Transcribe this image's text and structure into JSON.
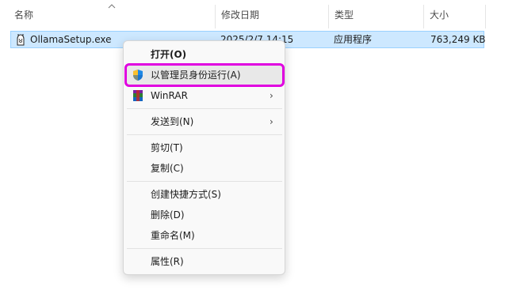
{
  "columns": {
    "name": "名称",
    "date": "修改日期",
    "type": "类型",
    "size": "大小"
  },
  "file": {
    "name": "OllamaSetup.exe",
    "date": "2025/2/7 14:15",
    "type": "应用程序",
    "size": "763,249 KB"
  },
  "menu": {
    "open": "打开(O)",
    "run_as_admin": "以管理员身份运行(A)",
    "winrar": "WinRAR",
    "send_to": "发送到(N)",
    "cut": "剪切(T)",
    "copy": "复制(C)",
    "create_shortcut": "创建快捷方式(S)",
    "delete": "删除(D)",
    "rename": "重命名(M)",
    "properties": "属性(R)"
  },
  "colors": {
    "selection": "#cde8ff",
    "highlight_outline": "#e000e0"
  }
}
